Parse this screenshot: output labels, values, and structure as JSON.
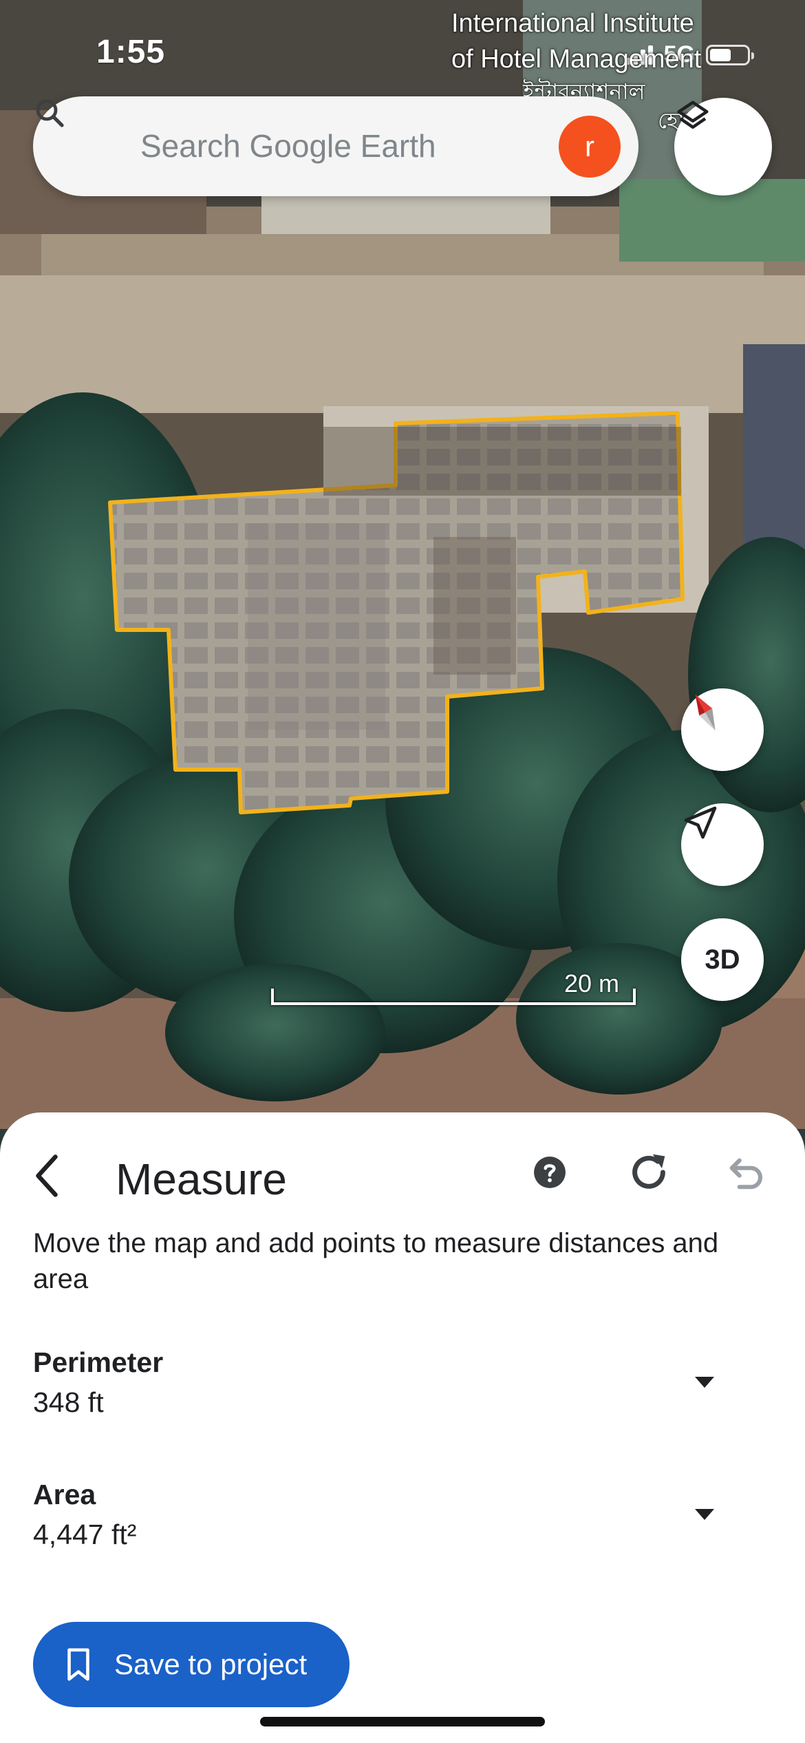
{
  "status_bar": {
    "time": "1:55",
    "network": "5G"
  },
  "map": {
    "place_label_line1": "International Institute",
    "place_label_line2": "of Hotel Management",
    "place_label_bengali_1": "ইন্টারন্যাশনাল",
    "place_label_bengali_2": "হোটেল",
    "scale_label": "20 m",
    "measure_outline_color": "#f2b21c"
  },
  "search": {
    "placeholder": "Search Google Earth",
    "avatar_letter": "r"
  },
  "controls": {
    "threed_label": "3D"
  },
  "icons": [
    "search-icon",
    "layers-icon",
    "compass-icon",
    "navigation-icon",
    "back-arrow-icon",
    "help-icon",
    "refresh-icon",
    "undo-icon",
    "dropdown-icon",
    "bookmark-icon"
  ],
  "measure": {
    "title": "Measure",
    "instructions": "Move the map and add points to measure distances and area",
    "perimeter_label": "Perimeter",
    "perimeter_value": "348 ft",
    "area_label": "Area",
    "area_value": "4,447 ft²",
    "save_label": "Save to project"
  },
  "colors": {
    "accent": "#1a61c8",
    "avatar": "#f4511e"
  }
}
